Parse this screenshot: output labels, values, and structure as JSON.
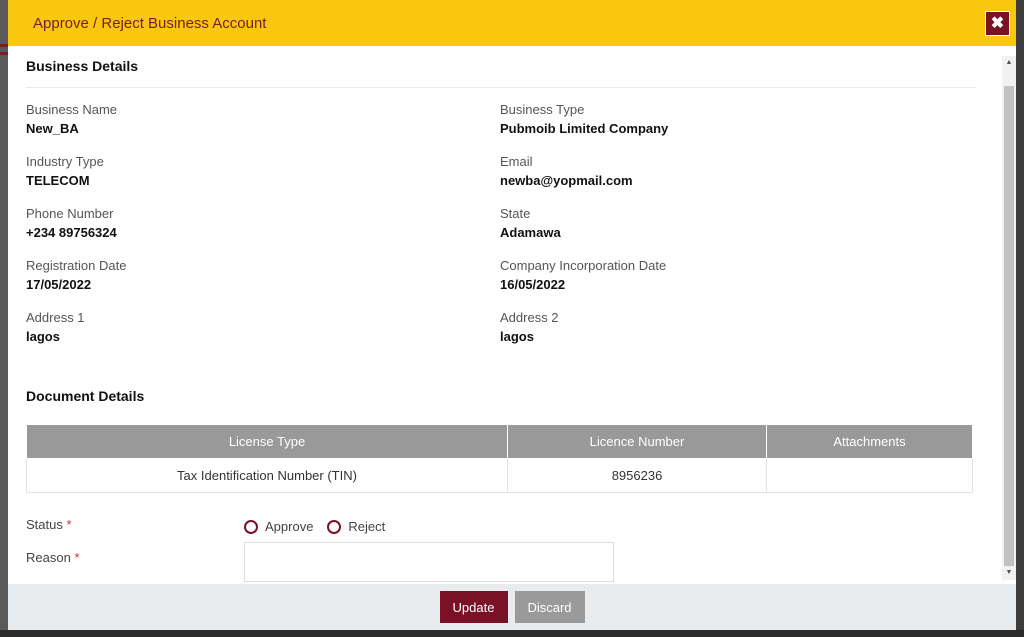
{
  "modal": {
    "title": "Approve / Reject Business Account",
    "close_icon": "close-icon",
    "accent_color": "#7b1124",
    "header_color": "#f9c80e"
  },
  "business": {
    "section_title": "Business Details",
    "fields": [
      {
        "label": "Business Name",
        "value": "New_BA"
      },
      {
        "label": "Business Type",
        "value": "Pubmoib Limited Company"
      },
      {
        "label": "Industry Type",
        "value": "TELECOM"
      },
      {
        "label": "Email",
        "value": "newba@yopmail.com"
      },
      {
        "label": "Phone Number",
        "value": "+234 89756324"
      },
      {
        "label": "State",
        "value": "Adamawa"
      },
      {
        "label": "Registration Date",
        "value": "17/05/2022"
      },
      {
        "label": "Company Incorporation Date",
        "value": "16/05/2022"
      },
      {
        "label": "Address 1",
        "value": "lagos"
      },
      {
        "label": "Address 2",
        "value": "lagos"
      }
    ]
  },
  "documents": {
    "section_title": "Document Details",
    "columns": [
      "License Type",
      "Licence Number",
      "Attachments"
    ],
    "rows": [
      [
        "Tax Identification Number (TIN)",
        "8956236",
        ""
      ]
    ]
  },
  "form": {
    "status_label": "Status",
    "required_mark": "*",
    "options": [
      "Approve",
      "Reject"
    ],
    "reason_label": "Reason",
    "reason_value": ""
  },
  "footer": {
    "update_label": "Update",
    "discard_label": "Discard"
  }
}
